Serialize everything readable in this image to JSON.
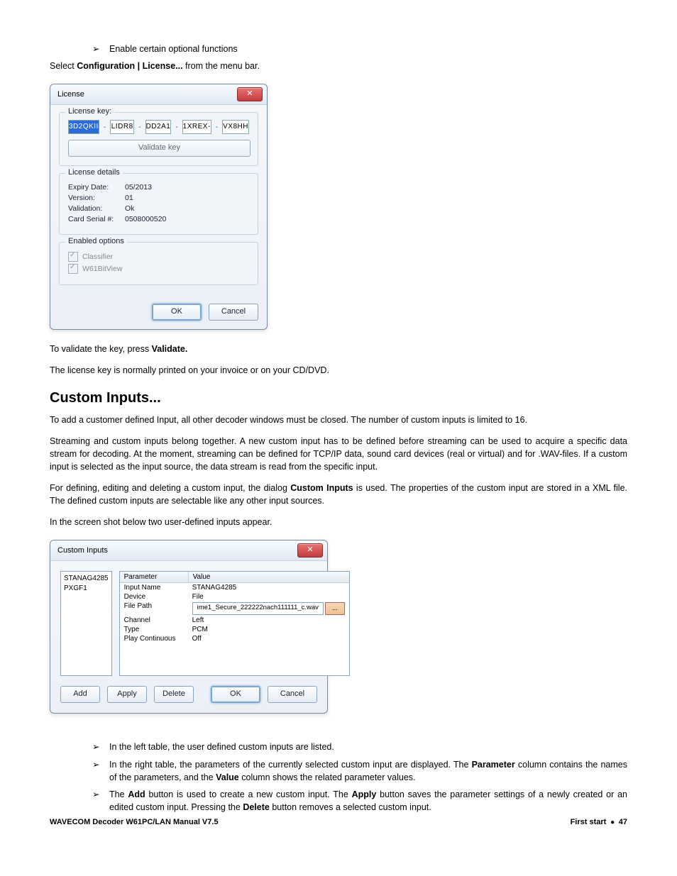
{
  "bullet_top": "Enable certain optional functions",
  "intro1_a": "Select ",
  "intro1_b": "Configuration | License...",
  "intro1_c": " from the menu bar.",
  "license_dlg": {
    "title": "License",
    "close": "✕",
    "grp_key": "License key:",
    "keys": [
      "3D2QKII",
      "LIDR8",
      "DD2A1",
      "1XREX-",
      "VX8HH"
    ],
    "validate_btn": "Validate key",
    "grp_details": "License details",
    "expiry_k": "Expiry Date:",
    "expiry_v": "05/2013",
    "version_k": "Version:",
    "version_v": "01",
    "validation_k": "Validation:",
    "validation_v": "Ok",
    "serial_k": "Card Serial #:",
    "serial_v": "0508000520",
    "grp_options": "Enabled options",
    "opt1": "Classifier",
    "opt2": "W61BitView",
    "ok": "OK",
    "cancel": "Cancel"
  },
  "para_validate_a": "To validate the key, press ",
  "para_validate_b": "Validate.",
  "para_key": "The license key is normally printed on your invoice or on your CD/DVD.",
  "heading_ci": "Custom Inputs...",
  "ci_p1": "To add a customer defined Input, all other decoder windows must be closed. The number of custom inputs is limited to 16.",
  "ci_p2": "Streaming and custom inputs belong together. A new custom input has to be defined before streaming can be used to acquire a specific data stream for decoding. At the moment, streaming can be defined for TCP/IP data, sound card devices (real or virtual) and for .WAV-files. If a custom input is selected as the input source, the data stream is read from the specific input.",
  "ci_p3_a": "For defining, editing and deleting a custom input, the dialog ",
  "ci_p3_b": "Custom Inputs",
  "ci_p3_c": " is used. The properties of the custom input are stored in a XML file. The defined custom inputs are selectable like any other input sources.",
  "ci_p4": "In the screen shot below two user-defined inputs appear.",
  "ci_dlg": {
    "title": "Custom Inputs",
    "close": "✕",
    "list": [
      "STANAG4285",
      "PXGF1"
    ],
    "col_param": "Parameter",
    "col_value": "Value",
    "rows": [
      {
        "p": "Input Name",
        "v": "STANAG4285"
      },
      {
        "p": "Device",
        "v": "File"
      },
      {
        "p": "File Path",
        "v": "ime1_Secure_222222nach111111_c.wav"
      },
      {
        "p": "Channel",
        "v": "Left"
      },
      {
        "p": "Type",
        "v": "PCM"
      },
      {
        "p": "Play Continuous",
        "v": "Off"
      }
    ],
    "dots": "...",
    "add": "Add",
    "apply": "Apply",
    "delete": "Delete",
    "ok": "OK",
    "cancel": "Cancel"
  },
  "b1": "In the left table, the user defined custom inputs are listed.",
  "b2_a": "In the right table, the parameters of the currently selected custom input are displayed. The ",
  "b2_b": "Parameter",
  "b2_c": " column contains the names of the parameters, and the ",
  "b2_d": "Value",
  "b2_e": " column shows the related parameter values.",
  "b3_a": "The ",
  "b3_b": "Add",
  "b3_c": " button is used to create a new custom input. The ",
  "b3_d": "Apply",
  "b3_e": " button saves the parameter settings of a newly created or an edited custom input. Pressing the ",
  "b3_f": "Delete",
  "b3_g": " button removes a selected custom input.",
  "footer_left": "WAVECOM Decoder W61PC/LAN Manual V7.5",
  "footer_right_a": "First start",
  "footer_right_b": "47"
}
